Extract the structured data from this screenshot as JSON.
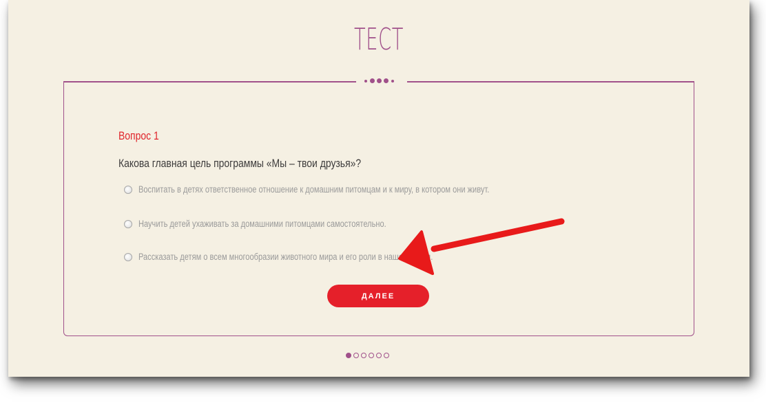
{
  "page": {
    "title": "ТЕСТ"
  },
  "question": {
    "number_label": "Вопрос 1",
    "text": "Какова главная цель программы «Мы – твои друзья»?",
    "options": [
      {
        "label": "Воспитать в детях ответственное отношение к домашним питомцам и к миру, в котором они живут.",
        "selected": false
      },
      {
        "label": "Научить детей ухаживать за домашними питомцами самостоятельно.",
        "selected": false
      },
      {
        "label": "Рассказать детям о всем многообразии животного мира и его роли в нашей жизни.",
        "selected": false
      }
    ]
  },
  "buttons": {
    "next_label": "ДАЛЕЕ"
  },
  "pager": {
    "total": 6,
    "current": 1
  },
  "colors": {
    "background": "#f5f0e3",
    "accent": "#a0508a",
    "button": "#e5202a",
    "question_number": "#e0242b",
    "annotation_arrow": "#e81a1a"
  },
  "icons": {
    "annotation": "red-arrow-icon",
    "separator": "dots-ornament-icon"
  }
}
